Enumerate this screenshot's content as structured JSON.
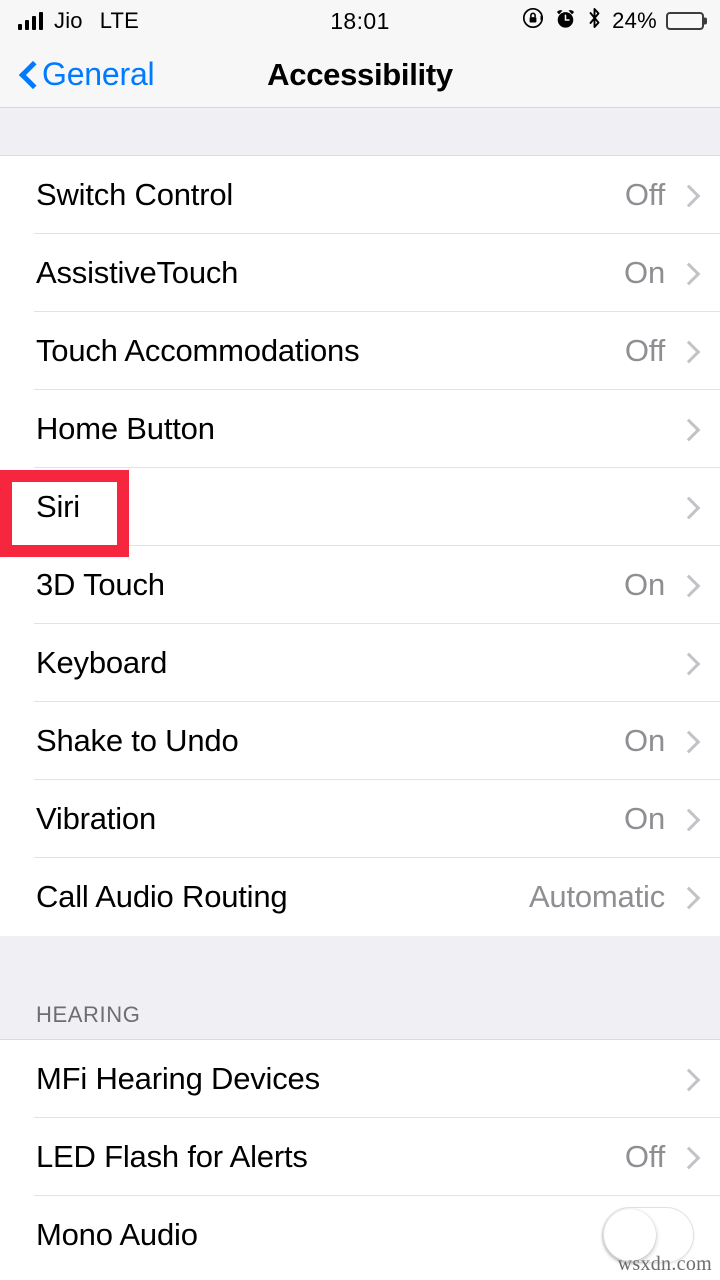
{
  "status_bar": {
    "carrier": "Jio",
    "radio_tech": "LTE",
    "time": "18:01",
    "battery_percent": "24%",
    "battery_level": 24,
    "icons": [
      "signal-bars-icon",
      "rotation-lock-icon",
      "alarm-clock-icon",
      "bluetooth-icon",
      "battery-icon"
    ]
  },
  "nav_bar": {
    "back_label": "General",
    "title": "Accessibility",
    "accent_color": "#007aff"
  },
  "groups": [
    {
      "header": "",
      "rows": [
        {
          "label": "Switch Control",
          "value": "Off",
          "accessory": "chevron"
        },
        {
          "label": "AssistiveTouch",
          "value": "On",
          "accessory": "chevron"
        },
        {
          "label": "Touch Accommodations",
          "value": "Off",
          "accessory": "chevron"
        },
        {
          "label": "Home Button",
          "value": "",
          "accessory": "chevron"
        },
        {
          "label": "Siri",
          "value": "",
          "accessory": "chevron"
        },
        {
          "label": "3D Touch",
          "value": "On",
          "accessory": "chevron"
        },
        {
          "label": "Keyboard",
          "value": "",
          "accessory": "chevron"
        },
        {
          "label": "Shake to Undo",
          "value": "On",
          "accessory": "chevron"
        },
        {
          "label": "Vibration",
          "value": "On",
          "accessory": "chevron"
        },
        {
          "label": "Call Audio Routing",
          "value": "Automatic",
          "accessory": "chevron"
        }
      ]
    },
    {
      "header": "HEARING",
      "rows": [
        {
          "label": "MFi Hearing Devices",
          "value": "",
          "accessory": "chevron"
        },
        {
          "label": "LED Flash for Alerts",
          "value": "Off",
          "accessory": "chevron"
        },
        {
          "label": "Mono Audio",
          "value": "",
          "accessory": "toggle",
          "toggle_on": false
        }
      ]
    }
  ],
  "annotation": {
    "highlight_target": "Siri",
    "highlight_color": "#f7263f"
  },
  "watermark": {
    "text": "wsxdn.com"
  }
}
